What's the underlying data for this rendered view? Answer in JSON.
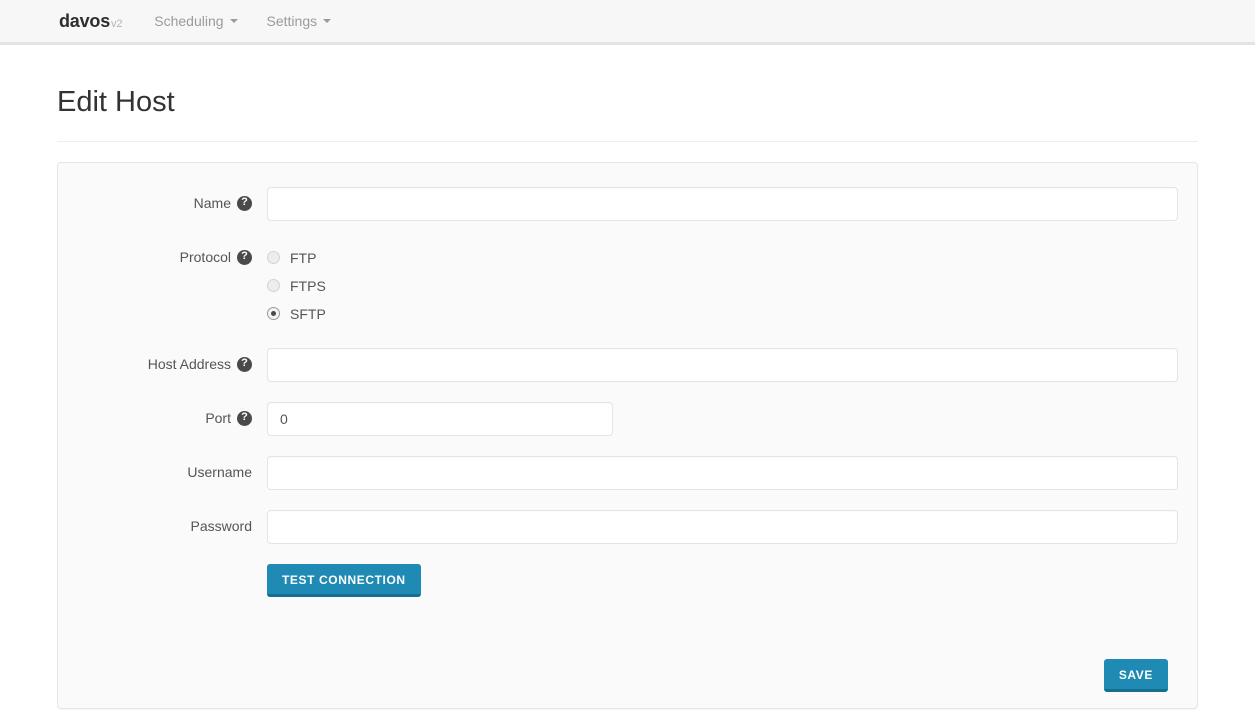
{
  "navbar": {
    "brand": "davos",
    "brand_version": "v2",
    "items": [
      {
        "label": "Scheduling",
        "has_caret": true
      },
      {
        "label": "Settings",
        "has_caret": true
      }
    ]
  },
  "page": {
    "title": "Edit Host"
  },
  "form": {
    "fields": {
      "name": {
        "label": "Name",
        "help": "?",
        "value": "",
        "placeholder": ""
      },
      "protocol": {
        "label": "Protocol",
        "help": "?",
        "options": [
          {
            "label": "FTP",
            "checked": false
          },
          {
            "label": "FTPS",
            "checked": false
          },
          {
            "label": "SFTP",
            "checked": true
          }
        ],
        "selected": "SFTP"
      },
      "host_address": {
        "label": "Host Address",
        "help": "?",
        "value": "",
        "placeholder": ""
      },
      "port": {
        "label": "Port",
        "help": "?",
        "value": "0",
        "placeholder": ""
      },
      "username": {
        "label": "Username",
        "value": "",
        "placeholder": ""
      },
      "password": {
        "label": "Password",
        "value": "",
        "placeholder": ""
      }
    },
    "buttons": {
      "test_connection": "TEST CONNECTION",
      "save": "SAVE"
    }
  },
  "colors": {
    "accent": "#1f8bb5",
    "accent_dark": "#166e90",
    "navbar_bg": "#f7f7f7",
    "navbar_border": "#e4e4e4",
    "panel_bg": "#fafafa",
    "panel_border": "#e6e6e6",
    "label_text": "#555555",
    "nav_text": "#9b9b9b",
    "help_icon_bg": "#4a4a4a"
  }
}
